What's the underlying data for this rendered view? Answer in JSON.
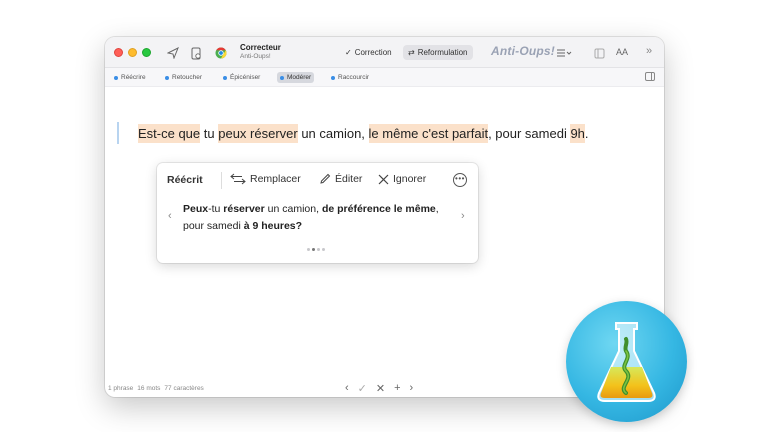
{
  "titlebar": {
    "app_name": "Correcteur",
    "app_subtitle": "Anti-Oups!",
    "mode_correction": "Correction",
    "mode_reformulation": "Reformulation",
    "brand": "Anti-Oups!",
    "font_size_label": "AA",
    "overflow": "»"
  },
  "modes": [
    {
      "label": "Réécrire",
      "active": false
    },
    {
      "label": "Retoucher",
      "active": false
    },
    {
      "label": "Épicéniser",
      "active": false
    },
    {
      "label": "Modérer",
      "active": true
    },
    {
      "label": "Raccourcir",
      "active": false
    }
  ],
  "document": {
    "segments": [
      {
        "text": "Est-ce que",
        "hl": true
      },
      {
        "text": " tu ",
        "hl": false
      },
      {
        "text": "peux réserver",
        "hl": true
      },
      {
        "text": " un camion, ",
        "hl": false
      },
      {
        "text": "le même c'est parfait",
        "hl": true
      },
      {
        "text": ", pour samedi ",
        "hl": false
      },
      {
        "text": "9h",
        "hl": true
      },
      {
        "text": ".",
        "hl": false
      }
    ]
  },
  "popup": {
    "title": "Réécrit",
    "replace": "Remplacer",
    "edit": "Éditer",
    "ignore": "Ignorer",
    "more": "•••",
    "prev": "‹",
    "next": "›",
    "suggestion": [
      {
        "text": "Peux",
        "bold": true
      },
      {
        "text": "-tu ",
        "bold": false
      },
      {
        "text": "réserver",
        "bold": true
      },
      {
        "text": " un camion, ",
        "bold": false
      },
      {
        "text": "de préférence le même",
        "bold": true
      },
      {
        "text": ", pour samedi ",
        "bold": false
      },
      {
        "text": "à 9 heures?",
        "bold": true
      }
    ],
    "pages": 4,
    "current_page": 2
  },
  "status": {
    "sentences": "1 phrase",
    "words": "16 mots",
    "chars": "77 caractères"
  },
  "bottom_nav": {
    "prev": "‹",
    "accept": "✓",
    "reject": "✕",
    "add": "+",
    "next": "›"
  },
  "colors": {
    "highlight": "#fbe1ca",
    "accent": "#3a8ee6",
    "badge": "#35b7e3"
  }
}
